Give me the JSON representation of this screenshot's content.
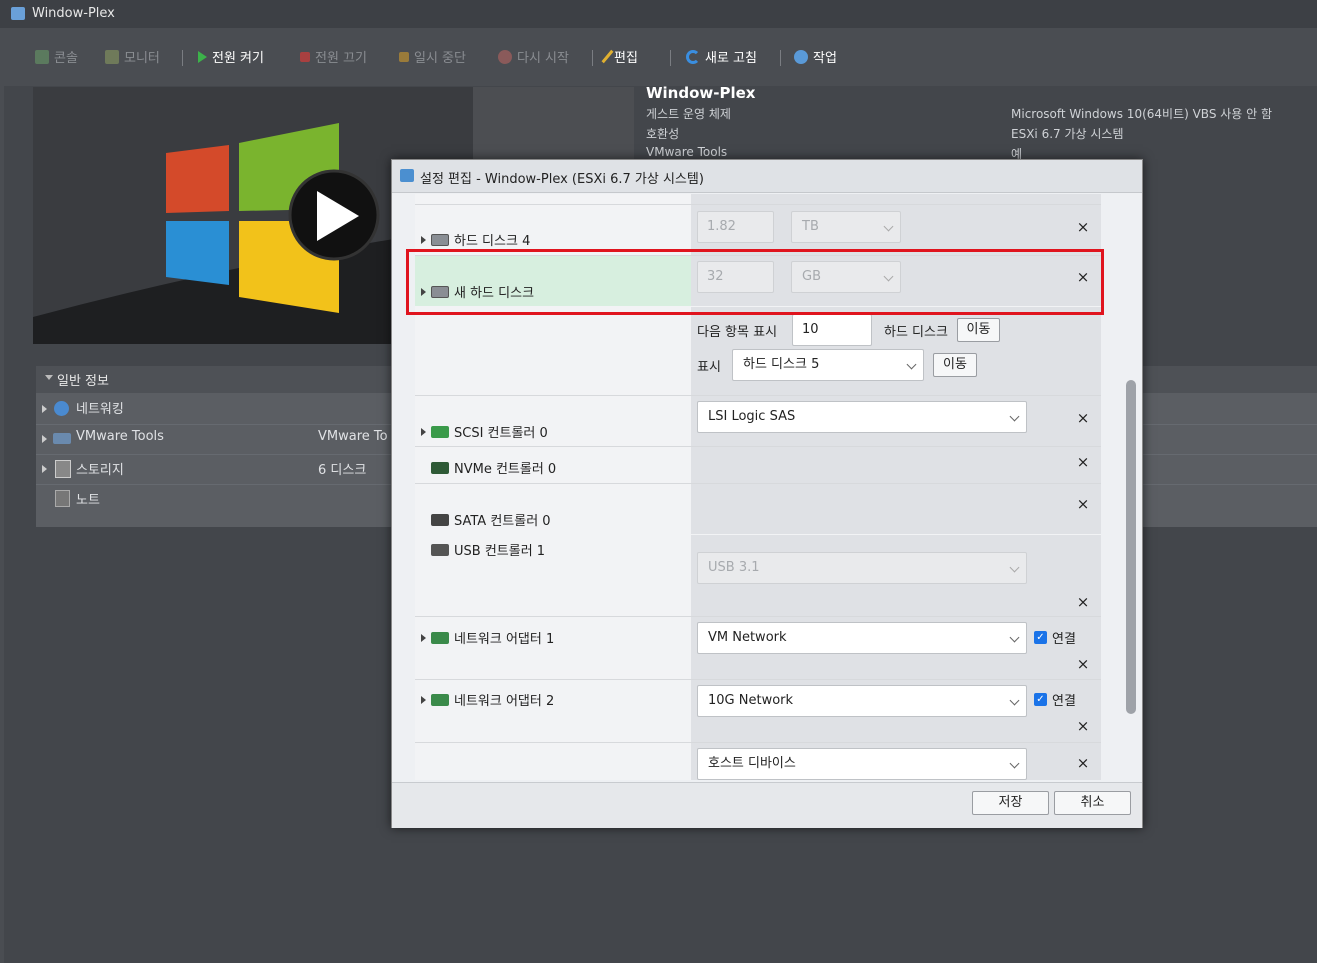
{
  "window": {
    "title": "Window-Plex"
  },
  "toolbar": {
    "console": "콘솔",
    "monitor": "모니터",
    "power_on": "전원 켜기",
    "power_off": "전원 끄기",
    "suspend": "일시 중단",
    "restart": "다시 시작",
    "edit": "편집",
    "refresh": "새로 고침",
    "actions": "작업"
  },
  "info": {
    "name": "Window-Plex",
    "guest_os_label": "게스트 운영 체제",
    "guest_os_value": "Microsoft Windows 10(64비트) VBS 사용 안 함",
    "compat_label": "호환성",
    "compat_value": "ESXi 6.7 가상 시스템",
    "tools_label": "VMware Tools",
    "tools_value": "예"
  },
  "general": {
    "title": "일반 정보",
    "rows": [
      {
        "label": "네트워킹",
        "value": ""
      },
      {
        "label": "VMware Tools",
        "value": "VMware To"
      },
      {
        "label": "스토리지",
        "value": "6 디스크"
      },
      {
        "label": "노트",
        "value": ""
      }
    ]
  },
  "dialog": {
    "title": "설정 편집 - Window-Plex (ESXi 6.7 가상 시스템)",
    "hdd4": {
      "label": "하드 디스크 4",
      "size": "1.82",
      "unit": "TB"
    },
    "newhdd": {
      "label": "새 하드 디스크",
      "size": "32",
      "unit": "GB"
    },
    "paging": {
      "show_next_label": "다음 항목 표시",
      "show_next_value": "10",
      "hdd_label": "하드 디스크",
      "move_label": "이동",
      "show_label": "표시",
      "show_value": "하드 디스크 5",
      "move2_label": "이동"
    },
    "scsi": {
      "label": "SCSI 컨트롤러 0",
      "value": "LSI Logic SAS"
    },
    "nvme": {
      "label": "NVMe 컨트롤러 0"
    },
    "sata": {
      "label": "SATA 컨트롤러 0"
    },
    "usb": {
      "label": "USB 컨트롤러 1",
      "value": "USB 3.1"
    },
    "net1": {
      "label": "네트워크 어댑터 1",
      "value": "VM Network",
      "connect": "연결"
    },
    "net2": {
      "label": "네트워크 어댑터 2",
      "value": "10G Network",
      "connect": "연결"
    },
    "host": {
      "value": "호스트 디바이스"
    },
    "close_glyph": "×",
    "save": "저장",
    "cancel": "취소"
  },
  "icons": [
    "vm-icon",
    "console-icon",
    "monitor-icon",
    "play-icon",
    "stop-icon",
    "pause-icon",
    "restart-icon",
    "pencil-icon",
    "refresh-icon",
    "gear-icon",
    "disk-icon",
    "scsi-icon",
    "nvme-icon",
    "sata-icon",
    "usb-icon",
    "nic-icon",
    "chevron-down-icon",
    "close-icon",
    "checkbox-icon"
  ],
  "colors": {
    "highlight": "#e0141e",
    "selected_row": "#d7efdf",
    "checkbox": "#1a73e8"
  }
}
